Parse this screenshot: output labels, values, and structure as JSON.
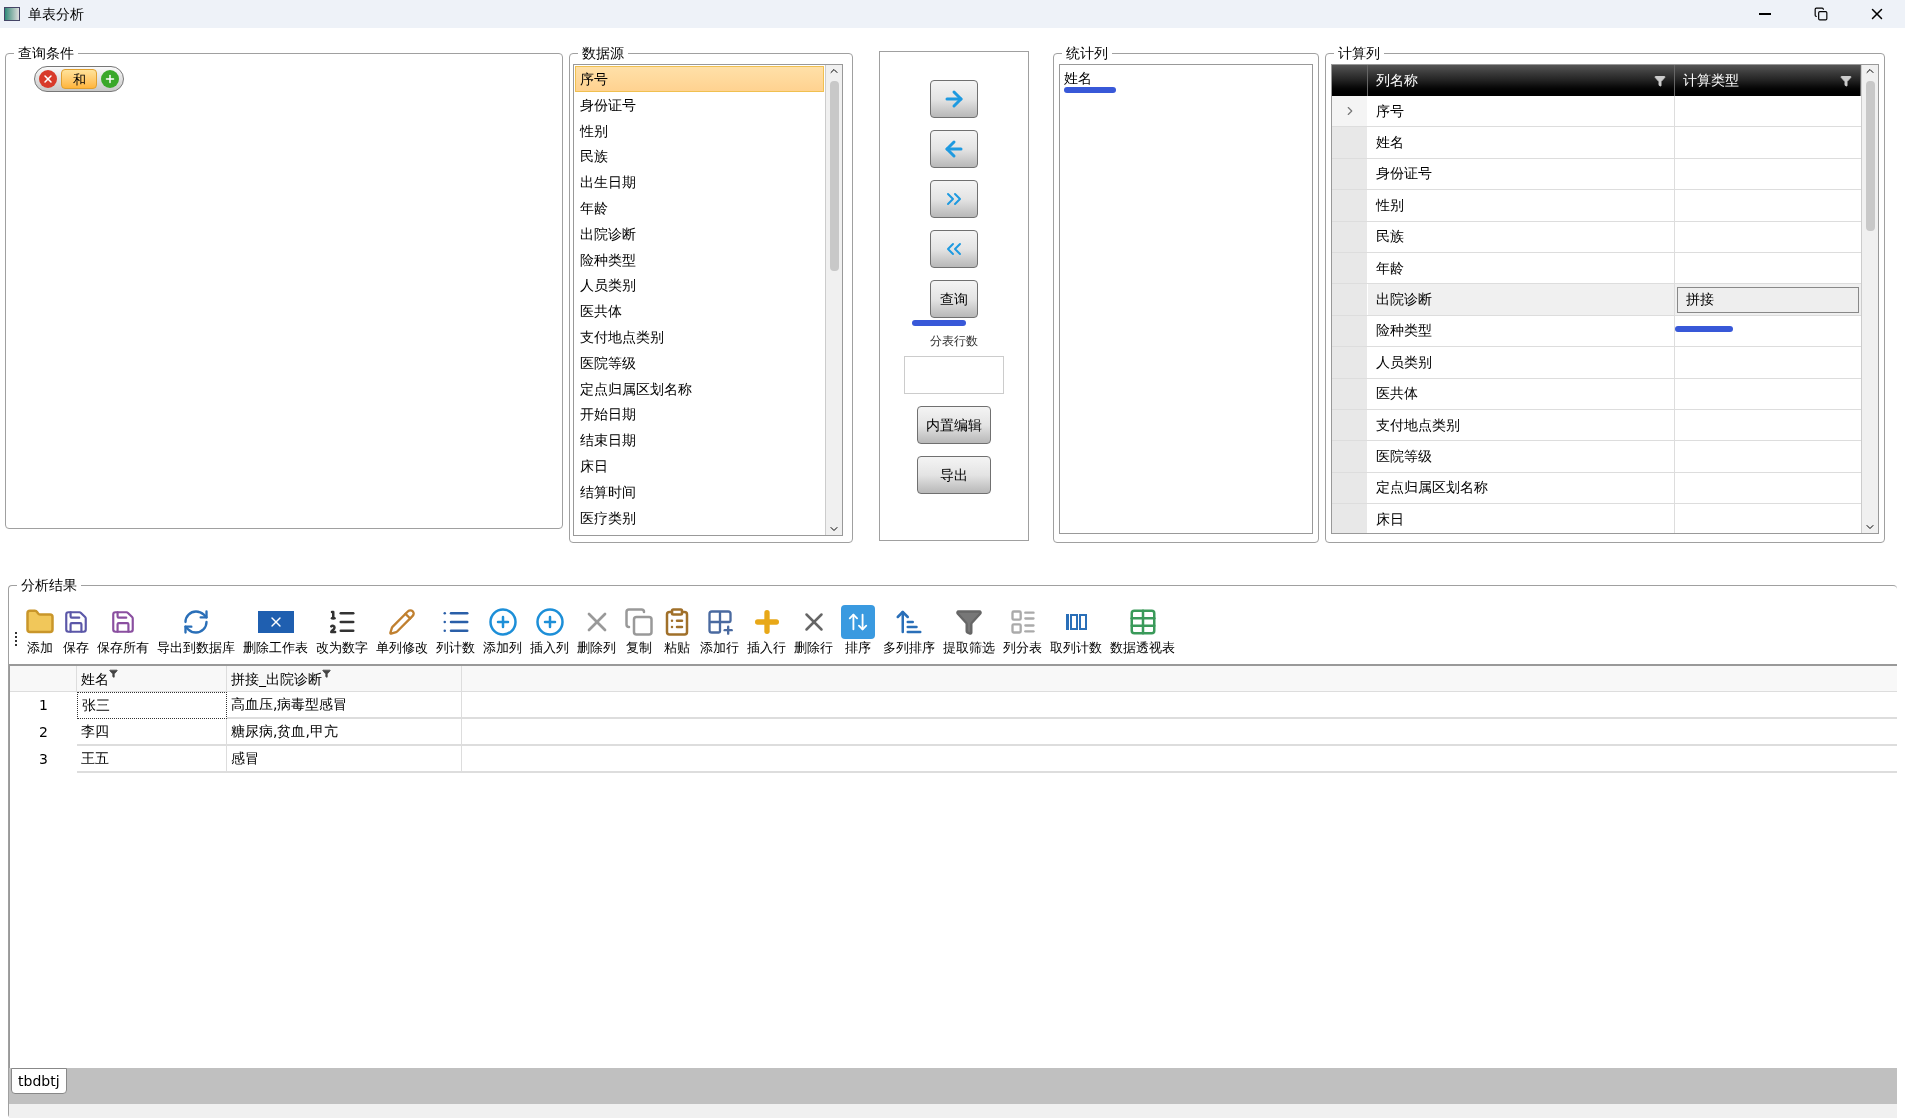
{
  "window": {
    "title": "单表分析"
  },
  "query": {
    "title": "查询条件",
    "condition": {
      "label": "和"
    }
  },
  "datasource": {
    "title": "数据源",
    "items": [
      {
        "label": "序号",
        "selected": true
      },
      {
        "label": "身份证号",
        "selected": false
      },
      {
        "label": "性别",
        "selected": false
      },
      {
        "label": "民族",
        "selected": false
      },
      {
        "label": "出生日期",
        "selected": false
      },
      {
        "label": "年龄",
        "selected": false
      },
      {
        "label": "出院诊断",
        "selected": false
      },
      {
        "label": "险种类型",
        "selected": false
      },
      {
        "label": "人员类别",
        "selected": false
      },
      {
        "label": "医共体",
        "selected": false
      },
      {
        "label": "支付地点类别",
        "selected": false
      },
      {
        "label": "医院等级",
        "selected": false
      },
      {
        "label": "定点归属区划名称",
        "selected": false
      },
      {
        "label": "开始日期",
        "selected": false
      },
      {
        "label": "结束日期",
        "selected": false
      },
      {
        "label": "床日",
        "selected": false
      },
      {
        "label": "结算时间",
        "selected": false
      },
      {
        "label": "医疗类别",
        "selected": false
      }
    ]
  },
  "actions": {
    "query_button": "查询",
    "rows_label": "分表行数",
    "edit_button": "内置编辑",
    "export_button": "导出"
  },
  "stats": {
    "title": "统计列",
    "items": [
      "姓名"
    ]
  },
  "calc": {
    "title": "计算列",
    "columns": [
      "列名称",
      "计算类型"
    ],
    "rows": [
      {
        "name": "序号",
        "type": "",
        "current": true,
        "selected": false
      },
      {
        "name": "姓名",
        "type": "",
        "current": false,
        "selected": false
      },
      {
        "name": "身份证号",
        "type": "",
        "current": false,
        "selected": false
      },
      {
        "name": "性别",
        "type": "",
        "current": false,
        "selected": false
      },
      {
        "name": "民族",
        "type": "",
        "current": false,
        "selected": false
      },
      {
        "name": "年龄",
        "type": "",
        "current": false,
        "selected": false
      },
      {
        "name": "出院诊断",
        "type": "拼接",
        "current": false,
        "selected": true
      },
      {
        "name": "险种类型",
        "type": "",
        "current": false,
        "selected": false
      },
      {
        "name": "人员类别",
        "type": "",
        "current": false,
        "selected": false
      },
      {
        "name": "医共体",
        "type": "",
        "current": false,
        "selected": false
      },
      {
        "name": "支付地点类别",
        "type": "",
        "current": false,
        "selected": false
      },
      {
        "name": "医院等级",
        "type": "",
        "current": false,
        "selected": false
      },
      {
        "name": "定点归属区划名称",
        "type": "",
        "current": false,
        "selected": false
      },
      {
        "name": "床日",
        "type": "",
        "current": false,
        "selected": false
      }
    ]
  },
  "results": {
    "title": "分析结果",
    "toolbar": [
      "添加",
      "保存",
      "保存所有",
      "导出到数据库",
      "删除工作表",
      "改为数字",
      "单列修改",
      "列计数",
      "添加列",
      "插入列",
      "删除列",
      "复制",
      "粘贴",
      "添加行",
      "插入行",
      "删除行",
      "排序",
      "多列排序",
      "提取筛选",
      "列分表",
      "取列计数",
      "数据透视表"
    ],
    "table": {
      "columns": [
        "姓名",
        "拼接_出院诊断"
      ],
      "rows": [
        {
          "index": "1",
          "cells": [
            "张三",
            "高血压,病毒型感冒"
          ],
          "focused": true
        },
        {
          "index": "2",
          "cells": [
            "李四",
            "糖尿病,贫血,甲亢"
          ],
          "focused": false
        },
        {
          "index": "3",
          "cells": [
            "王五",
            "感冒"
          ],
          "focused": false
        }
      ]
    },
    "sheet_tabs": [
      {
        "label": "tbdbtj",
        "selected": true
      }
    ]
  }
}
